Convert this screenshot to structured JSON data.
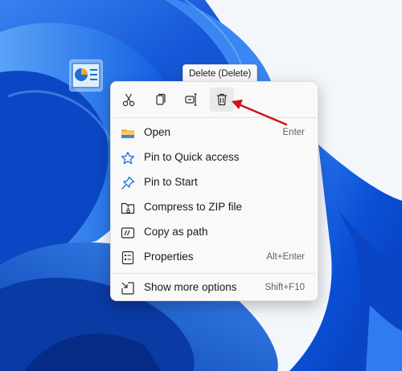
{
  "tooltip": {
    "text": "Delete (Delete)"
  },
  "toolbar": {
    "buttons": [
      {
        "icon": "cut-icon"
      },
      {
        "icon": "copy-icon"
      },
      {
        "icon": "rename-icon"
      },
      {
        "icon": "delete-icon",
        "state": "hover"
      }
    ]
  },
  "menu": {
    "items": [
      {
        "icon": "folder-icon",
        "label": "Open",
        "shortcut": "Enter"
      },
      {
        "icon": "star-icon",
        "label": "Pin to Quick access",
        "shortcut": ""
      },
      {
        "icon": "pin-icon",
        "label": "Pin to Start",
        "shortcut": ""
      },
      {
        "icon": "zip-icon",
        "label": "Compress to ZIP file",
        "shortcut": ""
      },
      {
        "icon": "copy-path-icon",
        "label": "Copy as path",
        "shortcut": ""
      },
      {
        "icon": "properties-icon",
        "label": "Properties",
        "shortcut": "Alt+Enter"
      }
    ],
    "more": {
      "icon": "show-more-icon",
      "label": "Show more options",
      "shortcut": "Shift+F10"
    }
  },
  "colors": {
    "accent": "#0067c0",
    "wallpaper_blue": "#0a53d8",
    "annotation_arrow": "#d0121b"
  }
}
